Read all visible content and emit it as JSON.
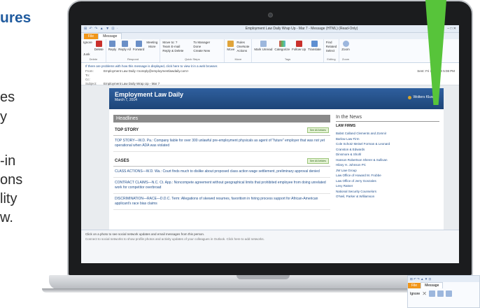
{
  "left_text": {
    "heading": "ures",
    "fragments": [
      "es",
      "y",
      "-in",
      "ons",
      "lity",
      "w."
    ]
  },
  "window": {
    "quick_access": "⊞ ↶ ↷ ▲ ▼ ⊡ ⋅",
    "title": "Employment Law Daily Wrap Up - Mar 7 - Message (HTML) (Read-Only)",
    "controls": "– □ ✕"
  },
  "tabs": {
    "file": "File",
    "message": "Message"
  },
  "ribbon": {
    "delete_group": {
      "ignore": "Ignore",
      "junk": "Junk",
      "delete": "Delete",
      "label": "Delete"
    },
    "respond_group": {
      "reply": "Reply",
      "reply_all": "Reply All",
      "forward": "Forward",
      "more": "More",
      "meeting": "Meeting",
      "label": "Respond"
    },
    "quicksteps_group": {
      "items": [
        "Move to: ?",
        "To Manager",
        "Team E-mail",
        "Done",
        "Reply & Delete",
        "Create New"
      ],
      "label": "Quick Steps"
    },
    "move_group": {
      "move": "Move",
      "rules": "Rules",
      "onenote": "OneNote",
      "actions": "Actions",
      "label": "Move"
    },
    "tags_group": {
      "mark_unread": "Mark Unread",
      "categorize": "Categorize",
      "follow_up": "Follow Up",
      "translate": "Translate",
      "label": "Tags"
    },
    "editing_group": {
      "find": "Find",
      "related": "Related",
      "select": "Select",
      "label": "Editing"
    },
    "zoom_group": {
      "zoom": "Zoom",
      "label": "Zoom"
    }
  },
  "message_header": {
    "info_bar": "If there are problems with how this message is displayed, click here to view it in a web browser.",
    "from_label": "From:",
    "from_value": "Employment Law Daily <noreply@employmentlawdaily.com>",
    "to_label": "To:",
    "cc_label": "Cc:",
    "subject_label": "Subject:",
    "subject_value": "Employment Law Daily Wrap Up - Mar 7",
    "sent": "Sent: Fri 3/7/2014 5:08 PM"
  },
  "newsletter": {
    "title": "Employment Law Daily",
    "date": "March 7, 2014",
    "brand": "Wolters Kluwer",
    "headlines_label": "Headlines",
    "sections": [
      {
        "name": "TOP STORY",
        "see_all": "See All Articles",
        "stories": [
          "TOP STORY—W.D. Pa.: Company liable for over 300 unlawful pre-employment physicals as agent of \"future\" employer that was not yet operational when ADA was violated"
        ]
      },
      {
        "name": "CASES",
        "see_all": "See All Articles",
        "stories": [
          "CLASS ACTIONS—W.D. Wa.: Court finds much to dislike about proposed class action wage settlement, preliminary approval denied",
          "CONTRACT CLAIMS—N.C. Ct. App.: Noncompete agreement without geographical limits that prohibited employee from doing unrelated work for competitor overbroad",
          "DISCRIMINATION—RACE—D.D.C. Term: Allegations of skewed resumes, favoritism in hiring process support for African-American applicant's race bias claims"
        ]
      }
    ],
    "sidebar": {
      "heading": "In the News",
      "subheading": "LAW FIRMS",
      "firms": [
        "Babst Calland Clements and Zomnir",
        "Barlow Law Firm",
        "Cole Schotz Meisel Forman & Leonard",
        "Cranston & Edwards",
        "Dinsmore & Shohl",
        "Hanson Robertson Sherer & Sullivan",
        "Hilary H. Johnson PC",
        "JW Law Group",
        "Law Office of Howard M. Frubbe",
        "Law Office of Jerry Gonzales",
        "Levy Ratner",
        "National Security Counselors",
        "O'Neil, Parker & Williamson"
      ]
    }
  },
  "people_pane": {
    "line1": "Click on a photo to see social network updates and email messages from this person.",
    "line2": "Connect to social networks to show profile photos and activity updates of your colleagues in Outlook. Click here to add networks."
  },
  "thumbnail": {
    "qat": "⊞ ↶ ↷ ▲ ▼ ⊡",
    "file_tab": "File",
    "message_tab": "Message",
    "ignore": "Ignore"
  },
  "colors": {
    "heading_blue": "#1f5a9e",
    "newsletter_blue": "#1d4578",
    "file_tab_orange": "#f0961a",
    "accent_green": "#57c43a"
  }
}
